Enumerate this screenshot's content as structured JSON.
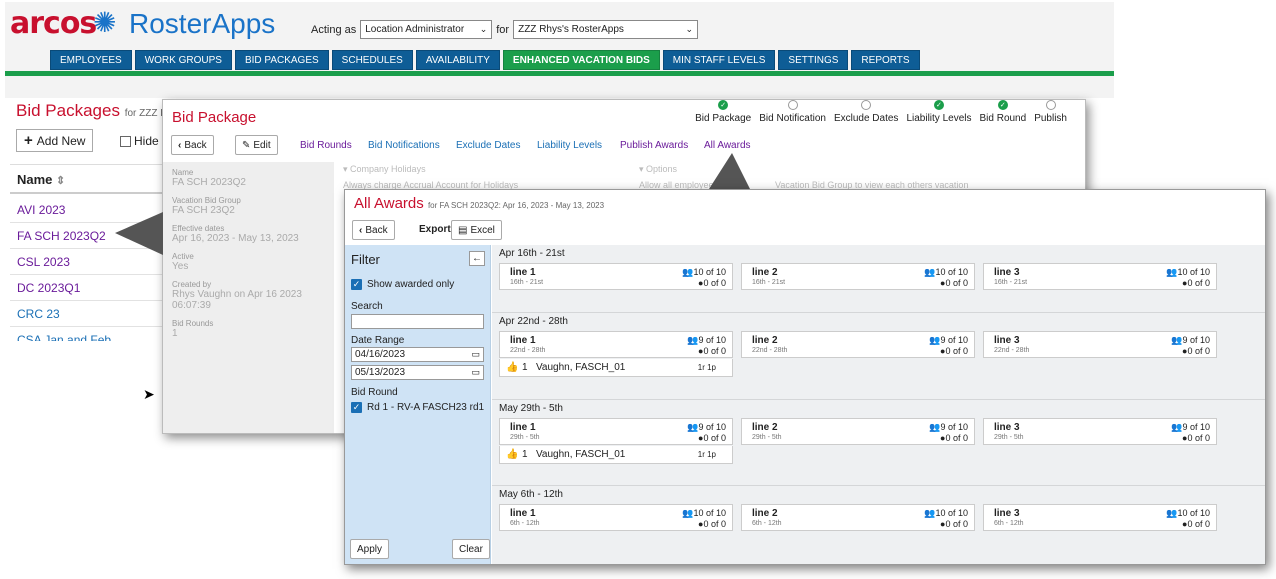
{
  "app": {
    "brand_arcos": "arcos",
    "brand_rosterapps": "RosterApps",
    "acting_as_label": "Acting as",
    "acting_as_value": "Location Administrator",
    "for_label": "for",
    "for_value": "ZZZ Rhys's RosterApps",
    "nav": [
      "EMPLOYEES",
      "WORK GROUPS",
      "BID PACKAGES",
      "SCHEDULES",
      "AVAILABILITY",
      "ENHANCED VACATION BIDS",
      "MIN STAFF LEVELS",
      "SETTINGS",
      "REPORTS"
    ],
    "nav_active": "ENHANCED VACATION BIDS",
    "accent_green": "#1b9e4b",
    "nav_blue": "#0e5d96",
    "title_red": "#c8102e"
  },
  "bid_packages": {
    "title": "Bid Packages",
    "subtitle": "for ZZZ Rh",
    "add_new": "Add New",
    "hide_label": "Hide F",
    "name_header": "Name",
    "rows": [
      {
        "name": "AVI 2023",
        "color": "#6a1b9a"
      },
      {
        "name": "FA SCH 2023Q2",
        "color": "#6a1b9a"
      },
      {
        "name": "CSL 2023",
        "color": "#6a1b9a"
      },
      {
        "name": "DC 2023Q1",
        "color": "#6a1b9a"
      },
      {
        "name": "CRC 23",
        "color": "#1a6fb5"
      },
      {
        "name": "CSA Jan and Feb",
        "color": "#1a6fb5"
      }
    ]
  },
  "bid_package": {
    "title": "Bid Package",
    "back": "Back",
    "edit": "Edit",
    "links": [
      "Bid Rounds",
      "Bid Notifications",
      "Exclude Dates",
      "Liability Levels",
      "Publish Awards",
      "All Awards"
    ],
    "steps": [
      {
        "label": "Bid Package",
        "done": true
      },
      {
        "label": "Bid Notification",
        "done": false
      },
      {
        "label": "Exclude Dates",
        "done": false
      },
      {
        "label": "Liability Levels",
        "done": true
      },
      {
        "label": "Bid Round",
        "done": true
      },
      {
        "label": "Publish",
        "done": false
      }
    ],
    "meta": [
      {
        "label": "Name",
        "value": "FA SCH 2023Q2"
      },
      {
        "label": "Vacation Bid Group",
        "value": "FA SCH 23Q2"
      },
      {
        "label": "Effective dates",
        "value": "Apr 16, 2023 - May 13, 2023"
      },
      {
        "label": "Active",
        "value": "Yes"
      },
      {
        "label": "Created by",
        "value": "Rhys Vaughn on Apr 16 2023 06:07:39"
      },
      {
        "label": "Bid Rounds",
        "value": "1"
      }
    ],
    "company_holidays": "Company Holidays",
    "always_charge": "Always charge Accrual Account for Holidays",
    "options": "Options",
    "allow_all": "Allow all employees",
    "vacation_view": "Vacation Bid Group to view each others vacation"
  },
  "all_awards": {
    "title": "All Awards",
    "subtitle": "for FA SCH 2023Q2: Apr 16, 2023 - May 13, 2023",
    "back": "Back",
    "export": "Export",
    "excel": "Excel",
    "filter": {
      "title": "Filter",
      "show_awarded_only": "Show awarded only",
      "search_label": "Search",
      "search_value": "",
      "date_range_label": "Date Range",
      "date_from": "04/16/2023",
      "date_to": "05/13/2023",
      "bid_round_label": "Bid Round",
      "bid_round_value": "Rd 1 - RV-A FASCH23 rd1",
      "apply": "Apply",
      "clear": "Clear"
    },
    "weeks": [
      {
        "label": "Apr 16th - 21st",
        "lines": [
          {
            "name": "line 1",
            "dates": "16th - 21st",
            "capacity": "10 of 10",
            "awarded": "0 of 0"
          },
          {
            "name": "line 2",
            "dates": "16th - 21st",
            "capacity": "10 of 10",
            "awarded": "0 of 0"
          },
          {
            "name": "line 3",
            "dates": "16th - 21st",
            "capacity": "10 of 10",
            "awarded": "0 of 0"
          }
        ],
        "awards": []
      },
      {
        "label": "Apr 22nd - 28th",
        "lines": [
          {
            "name": "line 1",
            "dates": "22nd - 28th",
            "capacity": "9 of 10",
            "awarded": "0 of 0"
          },
          {
            "name": "line 2",
            "dates": "22nd - 28th",
            "capacity": "9 of 10",
            "awarded": "0 of 0"
          },
          {
            "name": "line 3",
            "dates": "22nd - 28th",
            "capacity": "9 of 10",
            "awarded": "0 of 0"
          }
        ],
        "awards": [
          {
            "rank": "1",
            "name": "Vaughn, FASCH_01",
            "rp": "1r 1p"
          }
        ]
      },
      {
        "label": "May 29th - 5th",
        "lines": [
          {
            "name": "line 1",
            "dates": "29th - 5th",
            "capacity": "9 of 10",
            "awarded": "0 of 0"
          },
          {
            "name": "line 2",
            "dates": "29th - 5th",
            "capacity": "9 of 10",
            "awarded": "0 of 0"
          },
          {
            "name": "line 3",
            "dates": "29th - 5th",
            "capacity": "9 of 10",
            "awarded": "0 of 0"
          }
        ],
        "awards": [
          {
            "rank": "1",
            "name": "Vaughn, FASCH_01",
            "rp": "1r 1p"
          }
        ]
      },
      {
        "label": "May 6th - 12th",
        "lines": [
          {
            "name": "line 1",
            "dates": "6th - 12th",
            "capacity": "10 of 10",
            "awarded": "0 of 0"
          },
          {
            "name": "line 2",
            "dates": "6th - 12th",
            "capacity": "10 of 10",
            "awarded": "0 of 0"
          },
          {
            "name": "line 3",
            "dates": "6th - 12th",
            "capacity": "10 of 10",
            "awarded": "0 of 0"
          }
        ],
        "awards": []
      }
    ]
  }
}
